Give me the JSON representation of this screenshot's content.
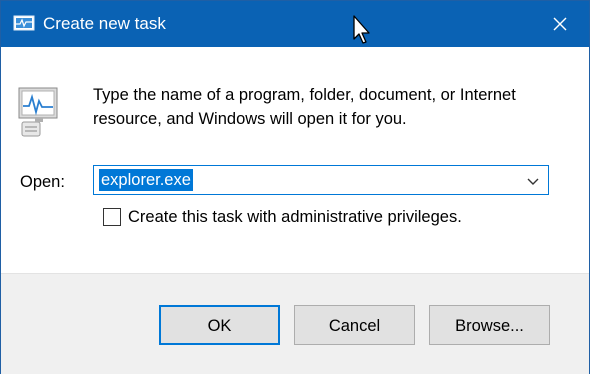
{
  "window": {
    "title": "Create new task",
    "title_icon": "task-manager-icon",
    "close_icon": "close-icon"
  },
  "dialog": {
    "description": "Type the name of a program, folder, document, or Internet resource, and Windows will open it for you.",
    "open_label": "Open:",
    "open_value": "explorer.exe",
    "admin_checkbox_label": "Create this task with administrative privileges.",
    "admin_checkbox_checked": false
  },
  "buttons": {
    "ok": "OK",
    "cancel": "Cancel",
    "browse": "Browse..."
  },
  "colors": {
    "titlebar": "#0a62b4",
    "accent": "#0078d7",
    "footer": "#f0f0f0"
  }
}
